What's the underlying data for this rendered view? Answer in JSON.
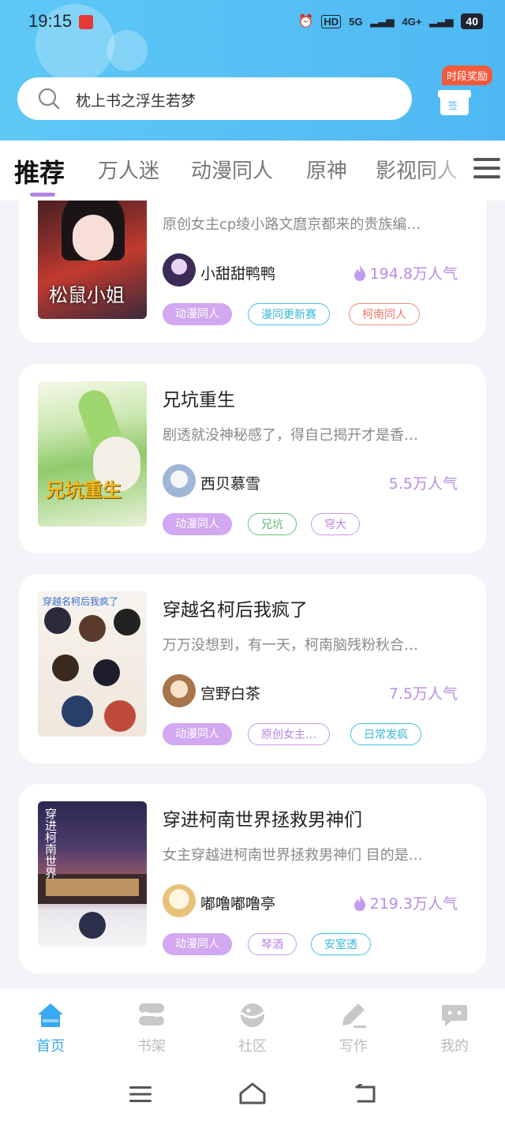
{
  "status": {
    "time": "19:15",
    "battery": "40",
    "network1": "5G",
    "network2": "4G+",
    "hd": "HD"
  },
  "search": {
    "placeholder": "枕上书之浮生若梦"
  },
  "reward": {
    "badge": "时段奖励",
    "sign_label": "签"
  },
  "tabs": [
    {
      "label": "推荐",
      "active": true
    },
    {
      "label": "万人迷"
    },
    {
      "label": "动漫同人"
    },
    {
      "label": "原神"
    },
    {
      "label": "影视同人"
    }
  ],
  "cards": [
    {
      "title": "",
      "description": "原创女主cp绫小路文麿京都来的贵族编…",
      "author": "小甜甜鸭鸭",
      "popularity": "194.8万人气",
      "hot": true,
      "cover_text": "松鼠小姐",
      "tags": [
        "动漫同人",
        "漫同更新赛",
        "柯南同人"
      ]
    },
    {
      "title": "兄坑重生",
      "description": "剧透就没神秘感了，得自己揭开才是香…",
      "author": "西贝慕雪",
      "popularity": "5.5万人气",
      "hot": false,
      "cover_text": "兄坑重生",
      "tags": [
        "动漫同人",
        "兄坑",
        "穹大"
      ]
    },
    {
      "title": "穿越名柯后我疯了",
      "description": "万万没想到，有一天，柯南脑残粉秋合…",
      "author": "宫野白茶",
      "popularity": "7.5万人气",
      "hot": false,
      "cover_text": "穿越名柯后我疯了",
      "tags": [
        "动漫同人",
        "原创女主…",
        "日常发疯"
      ]
    },
    {
      "title": "穿进柯南世界拯救男神们",
      "description": "女主穿越进柯南世界拯救男神们 目的是…",
      "author": "嘟噜嘟噜亭",
      "popularity": "219.3万人气",
      "hot": true,
      "cover_text": "穿进柯南世界",
      "tags": [
        "动漫同人",
        "琴酒",
        "安室透"
      ]
    }
  ],
  "nav": [
    {
      "label": "首页",
      "icon": "home-icon",
      "active": true
    },
    {
      "label": "书架",
      "icon": "bookshelf-icon"
    },
    {
      "label": "社区",
      "icon": "community-icon"
    },
    {
      "label": "写作",
      "icon": "pen-icon"
    },
    {
      "label": "我的",
      "icon": "profile-icon"
    }
  ],
  "colors": {
    "header": "#4fb8f3",
    "accent": "#b185e6",
    "active_nav": "#3aaaf0",
    "popularity": "#b98be8"
  }
}
